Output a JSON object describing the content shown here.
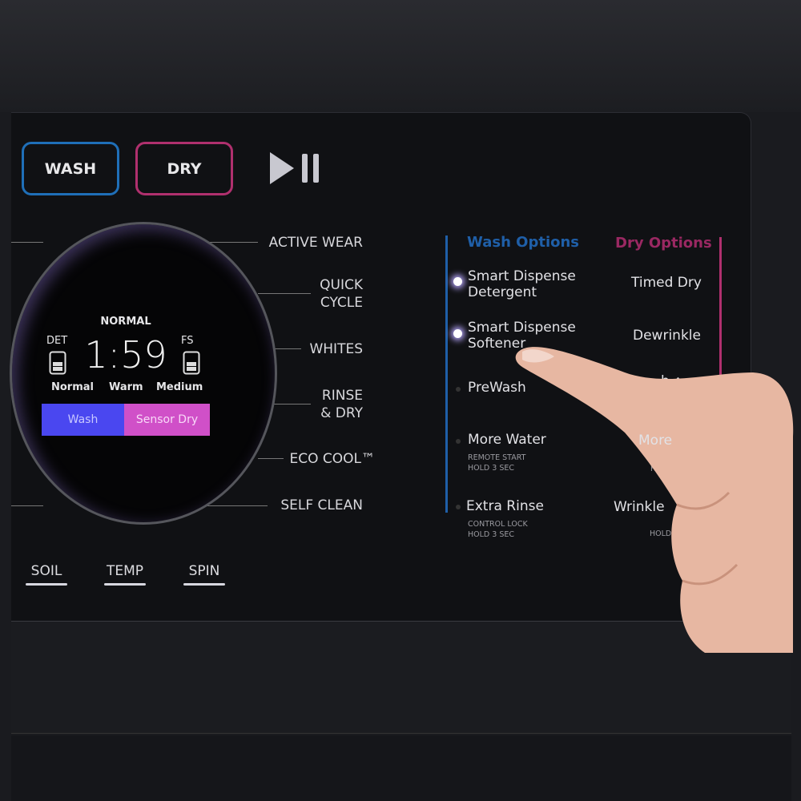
{
  "buttons": {
    "wash": "WASH",
    "dry": "DRY",
    "play_pause_icon": "play-pause-icon"
  },
  "colors": {
    "wash_accent": "#1f6fb8",
    "dry_accent": "#b0306e",
    "screen_wash": "#4a47f0",
    "screen_dry": "#d050c8"
  },
  "cycles": [
    "ACTIVE WEAR",
    "QUICK\nCYCLE",
    "WHITES",
    "RINSE\n& DRY",
    "ECO COOL™",
    "SELF CLEAN"
  ],
  "screen": {
    "cycle": "NORMAL",
    "time": "1:59",
    "det_label": "DET",
    "fs_label": "FS",
    "soil": "Normal",
    "temp": "Warm",
    "spin": "Medium",
    "wash_tab": "Wash",
    "dry_tab": "Sensor Dry"
  },
  "wash_options": {
    "title": "Wash Options",
    "items": [
      {
        "label": "Smart Dispense\nDetergent",
        "lit": true
      },
      {
        "label": "Smart Dispense\nSoftener",
        "lit": true
      },
      {
        "label": "PreWash",
        "lit": false
      },
      {
        "label": "More Water",
        "sub": "REMOTE START\nHOLD 3 SEC",
        "lit": false
      },
      {
        "label": "Extra Rinse",
        "sub": "CONTROL LOCK\nHOLD 3 SEC",
        "lit": false
      }
    ]
  },
  "dry_options": {
    "title": "Dry Options",
    "items": [
      {
        "label": "Timed Dry"
      },
      {
        "label": "Dewrinkle"
      },
      {
        "label": "h ⌂"
      },
      {
        "label": "More",
        "sub": "SOUN\nHOLD 3"
      },
      {
        "label": "Wrinkle",
        "sub": "HOLD 3"
      }
    ]
  },
  "selectors": [
    "SOIL",
    "TEMP",
    "SPIN"
  ]
}
